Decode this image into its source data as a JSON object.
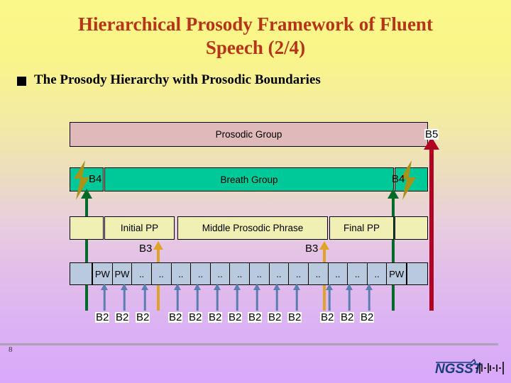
{
  "slide": {
    "title_line1": "Hierarchical Prosody Framework of Fluent",
    "title_line2": "Speech (2/4)",
    "bullet": "The Prosody Hierarchy with Prosodic Boundaries",
    "page_number": "8",
    "logo_text": "NGSST"
  },
  "colors": {
    "title": "#b5341a",
    "prosodic_group": "#e0b9bb",
    "breath_group": "#00c999",
    "prosodic_phrase": "#f0efb4",
    "prosodic_word": "#b9c9de",
    "b5_arrow": "#b00024",
    "b4_arrow": "#006b28",
    "b3_arrow": "#e0a32a",
    "b2_arrow": "#5a7fae",
    "lightning": "#a89319"
  },
  "diagram": {
    "rows": [
      {
        "id": "prosodic-group",
        "label": "Prosodic Group",
        "boundary_label": "B5"
      },
      {
        "id": "breath-group",
        "label": "Breath Group",
        "boundary_label_left": "B4",
        "boundary_label_right": "B4"
      },
      {
        "id": "prosodic-phrase",
        "cells": [
          "Initial PP",
          "Middle Prosodic Phrase",
          "Final PP"
        ],
        "boundary_label_left": "B3",
        "boundary_label_right": "B3"
      },
      {
        "id": "prosodic-word",
        "cells": [
          "PW",
          "PW",
          "..",
          "..",
          "..",
          "..",
          "..",
          "..",
          "..",
          "..",
          "..",
          "..",
          "..",
          "..",
          "..",
          "PW"
        ],
        "boundary_label": "B2"
      }
    ],
    "b2_labels": [
      "B2",
      "B2",
      "B2",
      "B2",
      "B2",
      "B2",
      "B2",
      "B2",
      "B2",
      "B2",
      "B2",
      "B2",
      "B2"
    ]
  }
}
